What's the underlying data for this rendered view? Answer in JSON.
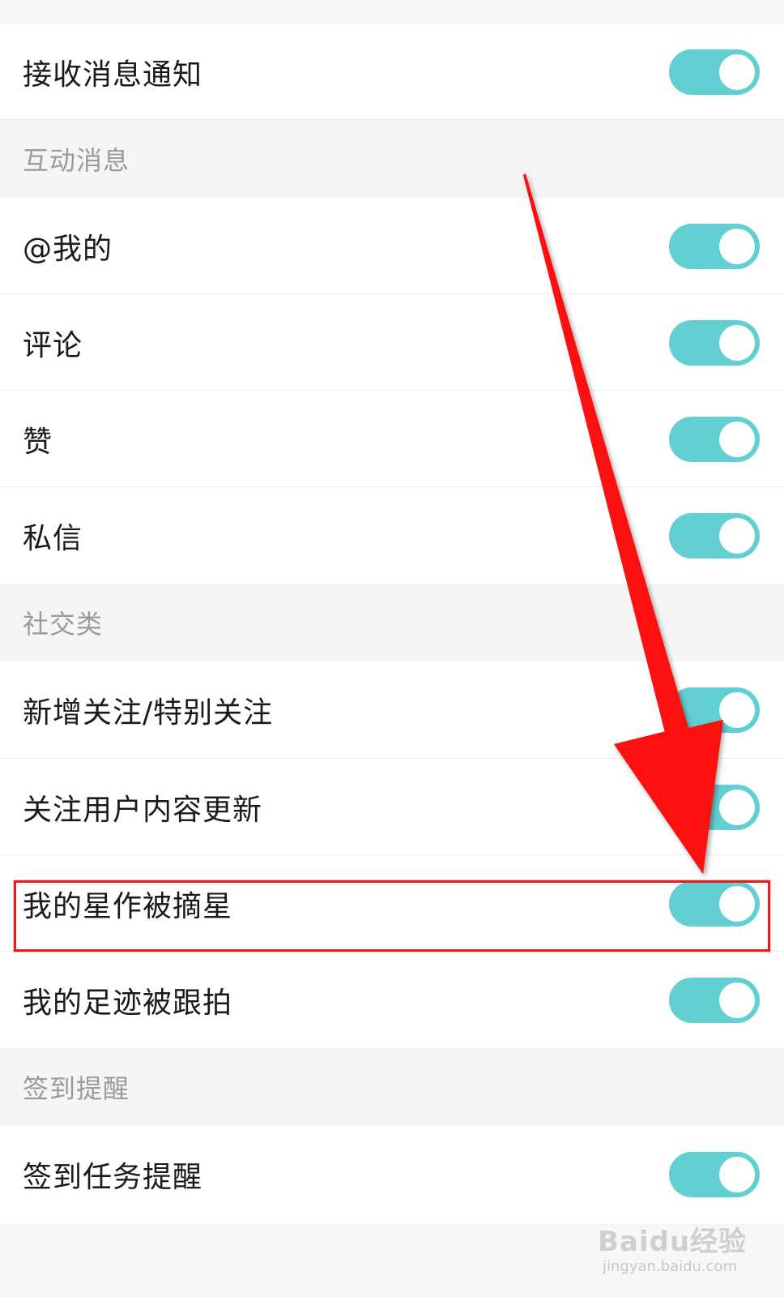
{
  "settings": {
    "receive_notifications": {
      "label": "接收消息通知",
      "enabled": true
    },
    "sections": [
      {
        "title": "互动消息",
        "items": [
          {
            "label": "@我的",
            "enabled": true
          },
          {
            "label": "评论",
            "enabled": true
          },
          {
            "label": "赞",
            "enabled": true
          },
          {
            "label": "私信",
            "enabled": true
          }
        ]
      },
      {
        "title": "社交类",
        "items": [
          {
            "label": "新增关注/特别关注",
            "enabled": true
          },
          {
            "label": "关注用户内容更新",
            "enabled": true
          },
          {
            "label": "我的星作被摘星",
            "enabled": true,
            "highlighted": true
          },
          {
            "label": "我的足迹被跟拍",
            "enabled": true
          }
        ]
      },
      {
        "title": "签到提醒",
        "items": [
          {
            "label": "签到任务提醒",
            "enabled": true
          }
        ]
      }
    ]
  },
  "colors": {
    "toggle_on": "#62cfd3",
    "annotation_red": "#e61e1e",
    "section_text": "#9a9a9a"
  },
  "watermark": {
    "brand": "Baidu经验",
    "url": "jingyan.baidu.com"
  }
}
